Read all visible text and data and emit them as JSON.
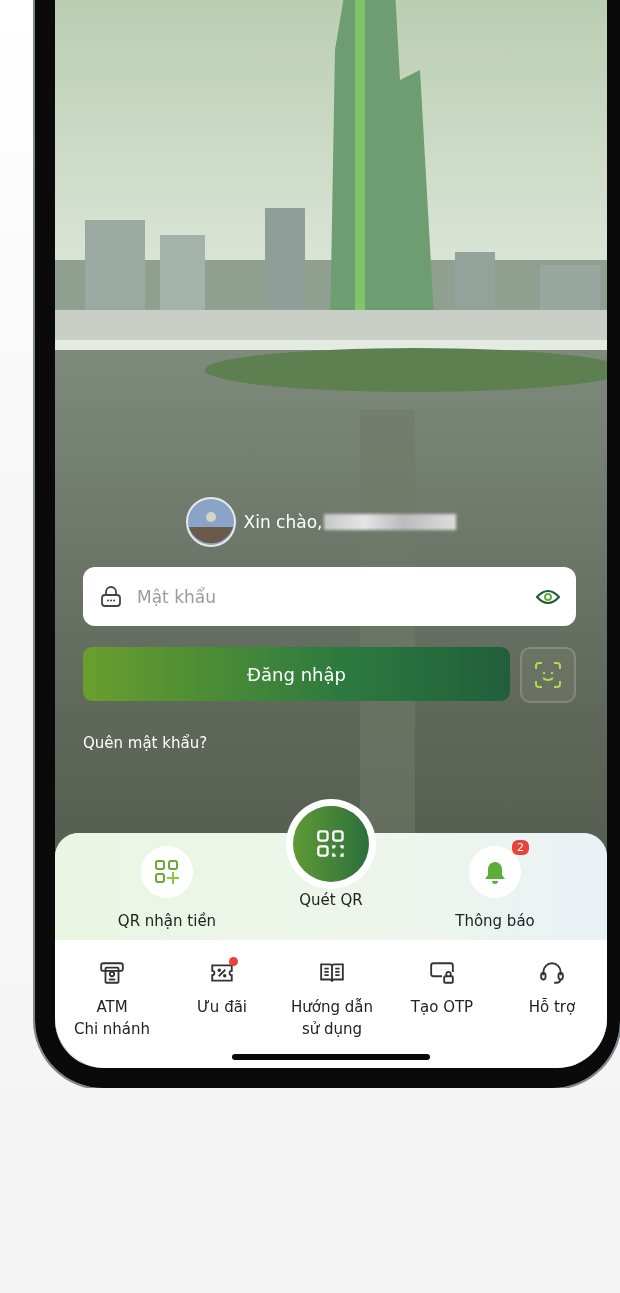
{
  "greeting": {
    "text": "Xin chào,",
    "name_hidden": true
  },
  "password_field": {
    "placeholder": "Mật khẩu"
  },
  "login_button": {
    "label": "Đăng nhập"
  },
  "forgot_password": {
    "label": "Quên mật khẩu?"
  },
  "quick_actions": [
    {
      "kind": "receive",
      "label": "QR nhận tiền"
    },
    {
      "kind": "scan",
      "label": "Quét QR"
    },
    {
      "kind": "notify",
      "label": "Thông báo",
      "badge": "2"
    }
  ],
  "shortcuts": [
    {
      "kind": "atm",
      "label": "ATM\nChi nhánh",
      "dot": false
    },
    {
      "kind": "offer",
      "label": "Ưu đãi",
      "dot": true
    },
    {
      "kind": "guide",
      "label": "Hướng dẫn\nsử dụng",
      "dot": false
    },
    {
      "kind": "otp",
      "label": "Tạo OTP",
      "dot": false
    },
    {
      "kind": "support",
      "label": "Hỗ trợ",
      "dot": false
    }
  ]
}
